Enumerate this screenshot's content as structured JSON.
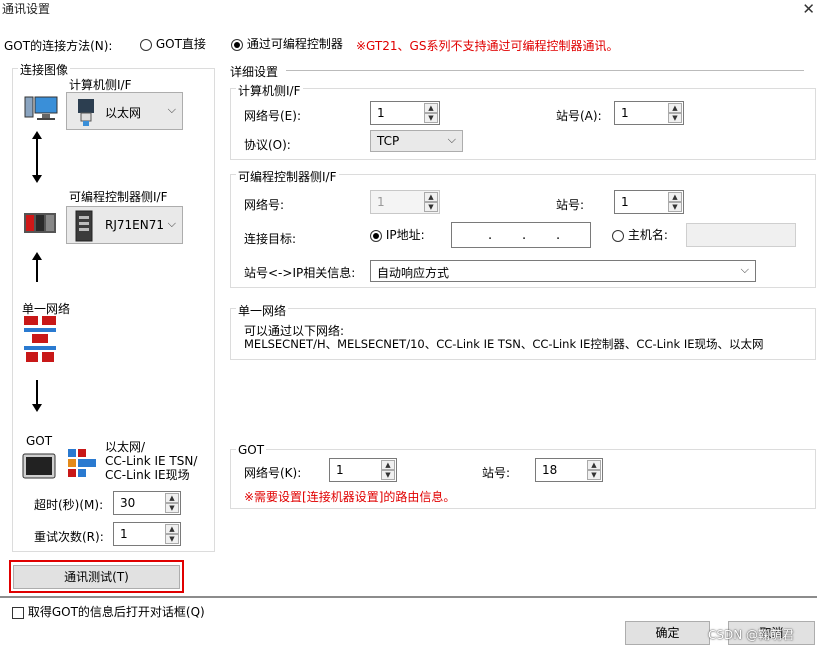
{
  "window": {
    "title": "通讯设置"
  },
  "connection_method": {
    "label": "GOT的连接方法(N):",
    "option_direct": "GOT直接",
    "option_plc": "通过可编程控制器",
    "warning": "※GT21、GS系列不支持通过可编程控制器通讯。"
  },
  "left": {
    "group_title": "连接图像",
    "pc_if_label": "计算机侧I/F",
    "pc_if_value": "以太网",
    "plc_if_label": "可编程控制器侧I/F",
    "plc_if_value": "RJ71EN71",
    "single_network": "单一网络",
    "got_label": "GOT",
    "got_network_lines": [
      "以太网/",
      "CC-Link IE TSN/",
      "CC-Link IE现场"
    ],
    "timeout_label": "超时(秒)(M):",
    "timeout_value": "30",
    "retry_label": "重试次数(R):",
    "retry_value": "1"
  },
  "details": {
    "title": "详细设置",
    "pc_if": {
      "title": "计算机侧I/F",
      "network_label": "网络号(E):",
      "network_value": "1",
      "station_label": "站号(A):",
      "station_value": "1",
      "protocol_label": "协议(O):",
      "protocol_value": "TCP"
    },
    "plc_if": {
      "title": "可编程控制器侧I/F",
      "network_label": "网络号:",
      "network_value": "1",
      "station_label": "站号:",
      "station_value": "1",
      "target_label": "连接目标:",
      "ip_option": "IP地址:",
      "ip_dots": ".",
      "host_option": "主机名:",
      "station_ip_label": "站号<->IP相关信息:",
      "station_ip_value": "自动响应方式"
    },
    "single_network": {
      "title": "单一网络",
      "line1": "可以通过以下网络:",
      "line2": "MELSECNET/H、MELSECNET/10、CC-Link IE TSN、CC-Link IE控制器、CC-Link IE现场、以太网"
    },
    "got": {
      "title": "GOT",
      "network_label": "网络号(K):",
      "network_value": "1",
      "station_label": "站号:",
      "station_value": "18",
      "note": "※需要设置[连接机器设置]的路由信息。"
    }
  },
  "buttons": {
    "comm_test": "通讯测试(T)",
    "ok": "确定",
    "cancel": "取消"
  },
  "footer": {
    "checkbox_label": "取得GOT的信息后打开对话框(Q)",
    "watermark": "CSDN @鞠萌君"
  },
  "colors": {
    "highlight_red": "#e00000",
    "warning_red": "#e00000"
  }
}
